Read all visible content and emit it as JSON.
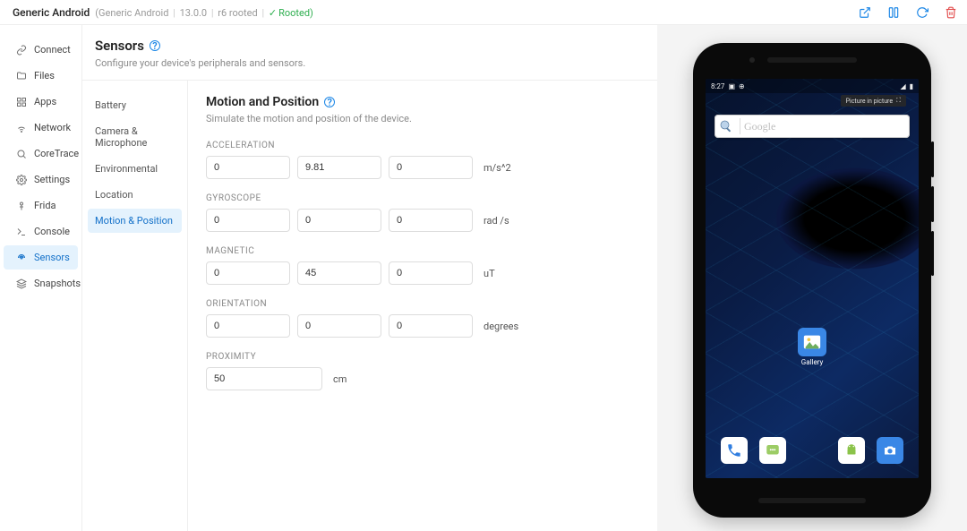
{
  "header": {
    "device_name": "Generic Android",
    "meta_prefix": "(Generic Android",
    "os": "13.0.0",
    "build": "r6 rooted",
    "rooted_label": "Rooted)",
    "actions": [
      "open-external",
      "columns",
      "refresh",
      "trash"
    ]
  },
  "leftnav": {
    "items": [
      {
        "key": "connect",
        "label": "Connect"
      },
      {
        "key": "files",
        "label": "Files"
      },
      {
        "key": "apps",
        "label": "Apps"
      },
      {
        "key": "network",
        "label": "Network"
      },
      {
        "key": "coretrace",
        "label": "CoreTrace"
      },
      {
        "key": "settings",
        "label": "Settings"
      },
      {
        "key": "frida",
        "label": "Frida"
      },
      {
        "key": "console",
        "label": "Console"
      },
      {
        "key": "sensors",
        "label": "Sensors"
      },
      {
        "key": "snapshots",
        "label": "Snapshots"
      }
    ],
    "active": "sensors"
  },
  "page": {
    "title": "Sensors",
    "subtitle": "Configure your device's peripherals and sensors."
  },
  "subnav": {
    "items": [
      "Battery",
      "Camera & Microphone",
      "Environmental",
      "Location",
      "Motion & Position"
    ],
    "active": 4
  },
  "panel": {
    "title": "Motion and Position",
    "subtitle": "Simulate the motion and position of the device.",
    "groups": [
      {
        "key": "acceleration",
        "label": "ACCELERATION",
        "values": [
          "0",
          "9.81",
          "0"
        ],
        "unit": "m/s^2"
      },
      {
        "key": "gyroscope",
        "label": "GYROSCOPE",
        "values": [
          "0",
          "0",
          "0"
        ],
        "unit": "rad /s"
      },
      {
        "key": "magnetic",
        "label": "MAGNETIC",
        "values": [
          "0",
          "45",
          "0"
        ],
        "unit": "uT"
      },
      {
        "key": "orientation",
        "label": "ORIENTATION",
        "values": [
          "0",
          "0",
          "0"
        ],
        "unit": "degrees"
      },
      {
        "key": "proximity",
        "label": "PROXIMITY",
        "values": [
          "50"
        ],
        "unit": "cm"
      }
    ]
  },
  "device_screen": {
    "status_time": "8:27",
    "pip_label": "Picture in picture",
    "search_placeholder": "Google",
    "gallery_label": "Gallery"
  }
}
